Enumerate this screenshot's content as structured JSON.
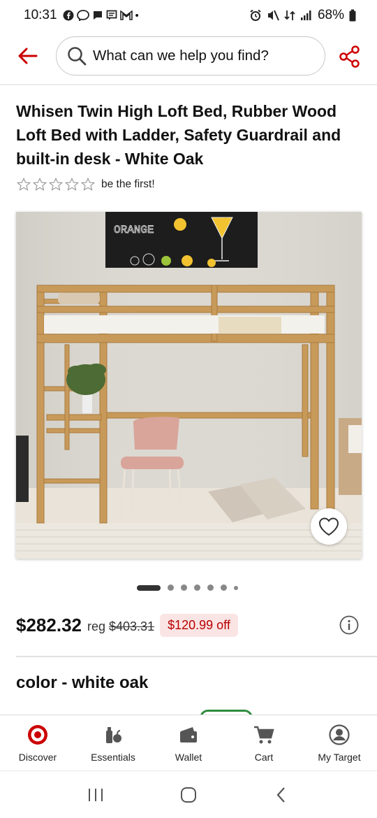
{
  "status_bar": {
    "time": "10:31",
    "battery": "68%",
    "notification_icons": [
      "facebook-icon",
      "messenger-icon",
      "chat-icon",
      "message-icon",
      "gmail-icon"
    ],
    "dot": "•"
  },
  "search": {
    "placeholder": "What can we help you find?"
  },
  "product": {
    "title": "Whisen Twin High Loft Bed, Rubber Wood Loft Bed with Ladder, Safety Guardrail and built-in desk - White Oak",
    "rating_text": "be the first!",
    "rating_stars": 0,
    "rating_max": 5,
    "image_poster_text": "ORANGE"
  },
  "carousel": {
    "active_index": 0,
    "total": 7
  },
  "price": {
    "current": "$282.32",
    "reg_label": "reg",
    "reg_value": "$403.31",
    "savings": "$120.99 off"
  },
  "color": {
    "heading": "color - white oak"
  },
  "bottom_nav": [
    {
      "label": "Discover",
      "icon": "target-logo-icon"
    },
    {
      "label": "Essentials",
      "icon": "essentials-icon"
    },
    {
      "label": "Wallet",
      "icon": "wallet-icon"
    },
    {
      "label": "Cart",
      "icon": "cart-icon"
    },
    {
      "label": "My Target",
      "icon": "account-icon"
    }
  ],
  "colors": {
    "brand_red": "#cc0000",
    "savings_bg": "#fbe4e4",
    "swatch_selected": "#2e8b3d"
  }
}
